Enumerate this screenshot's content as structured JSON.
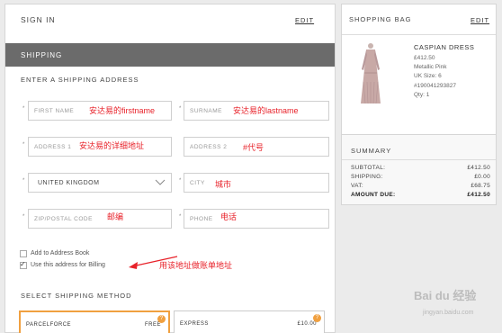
{
  "signin": {
    "title": "SIGN IN",
    "edit": "EDIT"
  },
  "shipping": {
    "title": "SHIPPING",
    "address_title": "ENTER A SHIPPING ADDRESS",
    "required_mark": "*",
    "fields": {
      "first_name": {
        "placeholder": "FIRST NAME",
        "note": "安达易的firstname"
      },
      "surname": {
        "placeholder": "SURNAME",
        "note": "安达易的lastname"
      },
      "address1": {
        "placeholder": "ADDRESS 1",
        "note": "安达易的详细地址"
      },
      "address2": {
        "placeholder": "ADDRESS 2",
        "note": "#代号"
      },
      "country": {
        "value": "UNITED KINGDOM"
      },
      "city": {
        "placeholder": "CITY",
        "note": "城市"
      },
      "zip": {
        "placeholder": "ZIP/POSTAL CODE",
        "note": "邮编"
      },
      "phone": {
        "placeholder": "PHONE",
        "note": "电话"
      }
    },
    "add_to_book": "Add to Address Book",
    "use_for_billing": "Use this address for Billing",
    "billing_note": "用该地址做账单地址",
    "check_mark": "✓",
    "method_title": "SELECT SHIPPING METHOD",
    "methods": [
      {
        "name": "PARCELFORCE",
        "price": "FREE",
        "badge": "?"
      },
      {
        "name": "EXPRESS",
        "price": "£10.00",
        "badge": "?"
      }
    ]
  },
  "bag": {
    "title": "SHOPPING BAG",
    "edit": "EDIT",
    "product": {
      "name": "CASPIAN DRESS",
      "price": "£412.50",
      "color": "Metallic Pink",
      "size": "UK Size: 6",
      "sku": "#190041293827",
      "qty": "Qty: 1"
    }
  },
  "summary": {
    "title": "SUMMARY",
    "rows": [
      {
        "label": "SUBTOTAL:",
        "value": "£412.50"
      },
      {
        "label": "SHIPPING:",
        "value": "£0.00"
      },
      {
        "label": "VAT:",
        "value": "£68.75"
      },
      {
        "label": "AMOUNT DUE:",
        "value": "£412.50"
      }
    ]
  },
  "watermark": {
    "main": "Bai du 经验",
    "sub": "jingyan.baidu.com"
  },
  "colors": {
    "accent": "#f0a040",
    "note_red": "#e8222a",
    "bar_gray": "#6b6b6b"
  }
}
